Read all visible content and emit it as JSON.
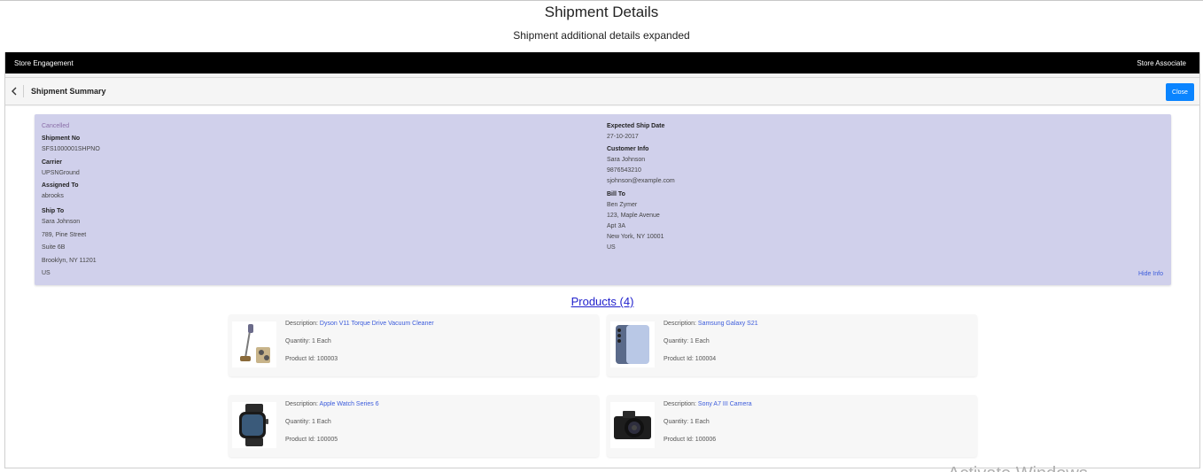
{
  "page": {
    "title": "Shipment Details",
    "subtitle": "Shipment additional details expanded"
  },
  "topbar": {
    "left_label": "Store Engagement",
    "right_label": "Store Associate"
  },
  "header": {
    "title": "Shipment Summary",
    "close_label": "Close"
  },
  "shipment": {
    "status": "Cancelled",
    "shipment_no_label": "Shipment No",
    "shipment_no": "SFS1000001SHPNO",
    "carrier_label": "Carrier",
    "carrier": "UPSNGround",
    "assigned_to_label": "Assigned To",
    "assigned_to": "abrooks",
    "ship_to_label": "Ship To",
    "ship_to": {
      "name": "Sara Johnson",
      "line1": "789, Pine Street",
      "line2": "Suite 6B",
      "city_line": "Brooklyn, NY 11201",
      "country": "US"
    },
    "expected_ship_date_label": "Expected Ship Date",
    "expected_ship_date": "27-10-2017",
    "customer_info_label": "Customer Info",
    "customer": {
      "name": "Sara Johnson",
      "phone": "9876543210",
      "email": "sjohnson@example.com"
    },
    "bill_to_label": "Bill To",
    "bill_to": {
      "name": "Ben Zymer",
      "line1": "123, Maple Avenue",
      "line2": "Apt 3A",
      "city_line": "New York, NY 10001",
      "country": "US"
    },
    "hide_info_label": "Hide Info"
  },
  "products": {
    "title": "Products (4)",
    "description_label": "Description: ",
    "items": [
      {
        "description": "Dyson V11 Torque Drive Vacuum Cleaner",
        "quantity": "Quantity: 1 Each",
        "product_id": "Product Id: 100003",
        "icon": "vacuum-icon"
      },
      {
        "description": "Samsung Galaxy S21",
        "quantity": "Quantity: 1 Each",
        "product_id": "Product Id: 100004",
        "icon": "phone-icon"
      },
      {
        "description": "Apple Watch Series 6",
        "quantity": "Quantity: 1 Each",
        "product_id": "Product Id: 100005",
        "icon": "watch-icon"
      },
      {
        "description": "Sony A7 III Camera",
        "quantity": "Quantity: 1 Each",
        "product_id": "Product Id: 100006",
        "icon": "camera-icon"
      }
    ]
  },
  "watermark": "Activate Windows",
  "colors": {
    "topbar": "#000000",
    "info_panel": "#d0d0eb",
    "accent_button": "#0a84ff",
    "link": "#3b5bdb"
  }
}
